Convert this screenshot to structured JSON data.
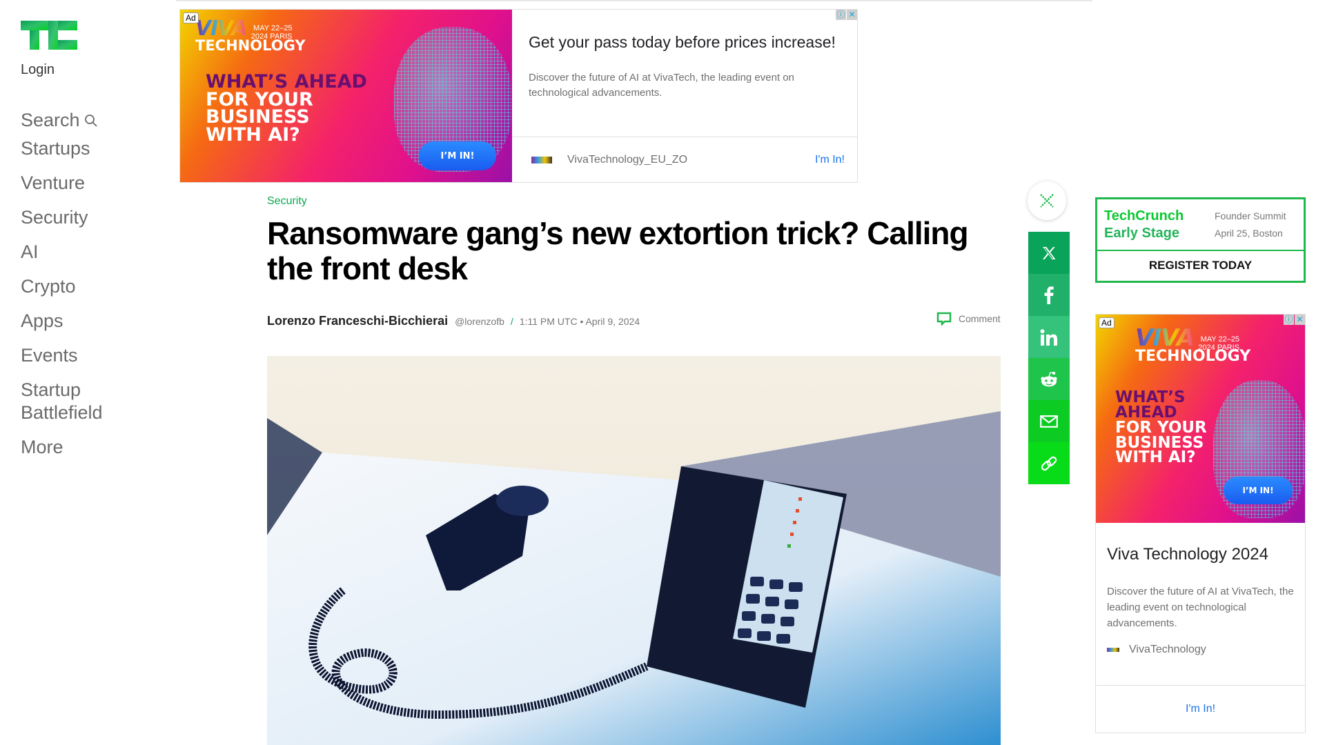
{
  "site": {
    "brand": "TechCrunch",
    "brand_colors": {
      "primary": "#0aa84f",
      "accent": "#0ac830"
    },
    "login_label": "Login"
  },
  "sidebar": {
    "search_label": "Search",
    "items": [
      {
        "label": "Startups"
      },
      {
        "label": "Venture"
      },
      {
        "label": "Security"
      },
      {
        "label": "AI"
      },
      {
        "label": "Crypto"
      },
      {
        "label": "Apps"
      },
      {
        "label": "Events"
      },
      {
        "label": "Startup Battlefield",
        "lines": [
          "Startup",
          "Battlefield"
        ]
      },
      {
        "label": "More"
      }
    ]
  },
  "top_ad": {
    "badge": "Ad",
    "creative": {
      "brand_word": "VIVA",
      "dates_line1": "MAY 22–25",
      "dates_line2": "2024 PARIS",
      "brand_sub": "TECHNOLOGY",
      "headline_purple": "WHAT’S AHEAD",
      "headline_white_1": "FOR YOUR",
      "headline_white_2": "BUSINESS",
      "headline_white_3": "WITH AI?",
      "cta": "I’M IN!"
    },
    "title": "Get your pass today before prices increase!",
    "description": "Discover the future of AI at VivaTech, the leading event on technological advancements.",
    "advertiser": "VivaTechnology_EU_ZO",
    "link_label": "I'm In!",
    "adchoices_info": "ⓘ",
    "adchoices_close": "✕"
  },
  "article": {
    "category": "Security",
    "title": "Ransomware gang’s new extortion trick? Calling the front desk",
    "author": "Lorenzo Franceschi-Bicchierai",
    "handle": "@lorenzofb",
    "separator": "/",
    "timestamp": "1:11 PM UTC • April 9, 2024",
    "comment_label": "Comment",
    "image_alt": "Office desk phone with handset off the hook"
  },
  "share": {
    "close_icon": "close-icon",
    "buttons": [
      {
        "name": "x",
        "icon": "x-logo-icon",
        "color": "#09a45a"
      },
      {
        "name": "facebook",
        "icon": "facebook-icon",
        "color": "#20b06a"
      },
      {
        "name": "linkedin",
        "icon": "linkedin-icon",
        "color": "#35c27a"
      },
      {
        "name": "reddit",
        "icon": "reddit-icon",
        "color": "#1fc44a"
      },
      {
        "name": "email",
        "icon": "mail-icon",
        "color": "#0ccc24"
      },
      {
        "name": "copy-link",
        "icon": "link-icon",
        "color": "#08dc18"
      }
    ]
  },
  "event_promo": {
    "name_line1": "TechCrunch",
    "name_line2": "Early Stage",
    "info_line1": "Founder Summit",
    "info_line2": "April 25, Boston",
    "cta": "REGISTER TODAY"
  },
  "side_ad": {
    "badge": "Ad",
    "creative": {
      "brand_word": "VIVA",
      "dates_line1": "MAY 22–25",
      "dates_line2": "2024 PARIS",
      "brand_sub": "TECHNOLOGY",
      "headline_purple_1": "WHAT’S",
      "headline_purple_2": "AHEAD",
      "headline_white_1": "FOR YOUR",
      "headline_white_2": "BUSINESS",
      "headline_white_3": "WITH AI?",
      "cta": "I’M IN!"
    },
    "title": "Viva Technology 2024",
    "description": "Discover the future of AI at VivaTech, the leading event on technological advancements.",
    "advertiser": "VivaTechnology",
    "link_label": "I'm In!",
    "adchoices_info": "ⓘ",
    "adchoices_close": "✕"
  }
}
